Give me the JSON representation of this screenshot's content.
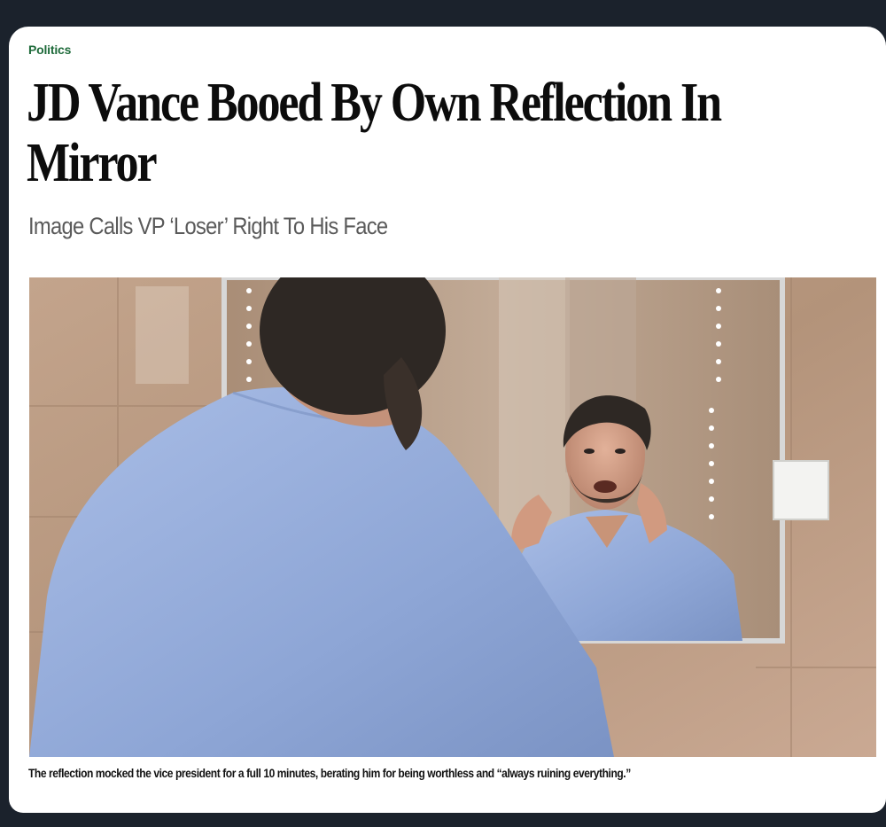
{
  "article": {
    "category": "Politics",
    "headline": "JD Vance Booed By Own Reflection In Mirror",
    "subheadline": "Image Calls VP ‘Loser’ Right To His Face",
    "caption": "The reflection mocked the vice president for a full 10 minutes, berating him for being worthless and “always ruining everything.”"
  },
  "photo": {
    "description_icon": "photo-illustration",
    "colors": {
      "wall": "#b89a82",
      "shirt": "#8fa8d8",
      "hair": "#2e2824",
      "mirror_frame": "#c9c9c9"
    }
  },
  "theme": {
    "background": "#1b222c",
    "card": "#ffffff",
    "category_color": "#1f6b3b",
    "headline_color": "#0c0c0c",
    "subhead_color": "#5a5a5a"
  }
}
